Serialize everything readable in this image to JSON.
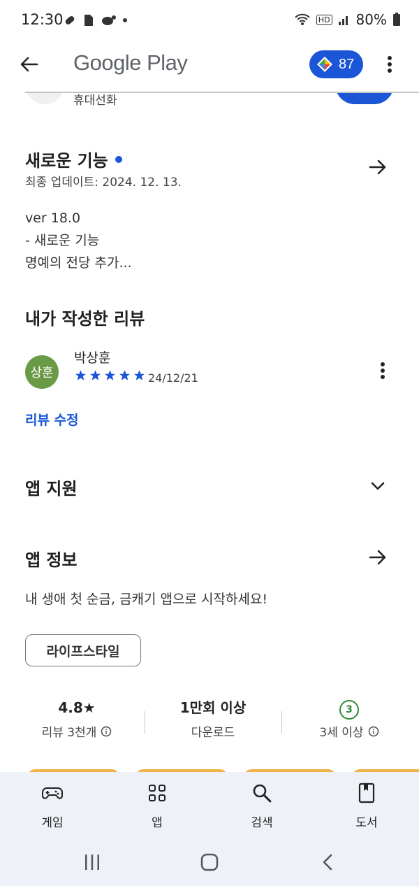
{
  "status_bar": {
    "time": "12:30",
    "network_label": "HD",
    "battery": "80%"
  },
  "header": {
    "title": "Google Play",
    "points": "87"
  },
  "app_row": {
    "category": "휴대선화"
  },
  "whats_new": {
    "title": "새로운 기능",
    "updated": "최종 업데이트: 2024. 12. 13.",
    "notes": [
      "ver 18.0",
      "- 새로운 기능",
      "명예의 전당 추가..."
    ]
  },
  "my_review": {
    "section_title": "내가 작성한 리뷰",
    "avatar_text": "상훈",
    "reviewer": "박상훈",
    "rating": 5,
    "date": "24/12/21",
    "edit_label": "리뷰 수정"
  },
  "app_support": {
    "title": "앱 지원"
  },
  "app_info": {
    "title": "앱 정보",
    "description": "내 생애 첫 순금, 금캐기 앱으로 시작하세요!",
    "category_chip": "라이프스타일"
  },
  "stats": {
    "rating": "4.8★",
    "reviews": "리뷰 3천개",
    "downloads": "1만회 이상",
    "downloads_label": "다운로드",
    "age_rating": "3",
    "age_label": "3세 이상"
  },
  "bottom_nav": {
    "items": [
      {
        "label": "게임",
        "icon": "gamepad-icon"
      },
      {
        "label": "앱",
        "icon": "apps-grid-icon"
      },
      {
        "label": "검색",
        "icon": "search-icon"
      },
      {
        "label": "도서",
        "icon": "book-icon"
      }
    ]
  },
  "colors": {
    "accent": "#1a56d6",
    "avatar": "#6a9a45",
    "age_badge": "#2e8b3a",
    "nav_bg": "#eef2f8"
  }
}
